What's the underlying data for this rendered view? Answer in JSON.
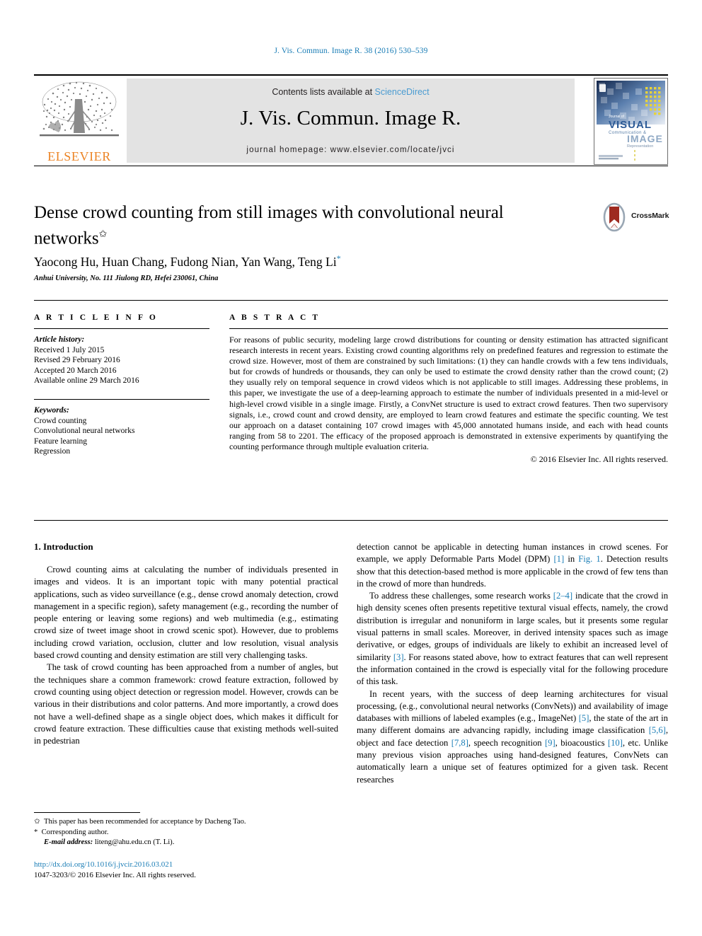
{
  "running_head": "J. Vis. Commun. Image R. 38 (2016) 530–539",
  "masthead": {
    "publisher_name": "ELSEVIER",
    "contents_prefix": "Contents lists available at ",
    "contents_link": "ScienceDirect",
    "journal_title": "J. Vis. Commun. Image R.",
    "homepage": "journal homepage: www.elsevier.com/locate/jvci",
    "cover_caption_1": "VISUAL",
    "cover_caption_2": "Communication &",
    "cover_caption_3": "IMAGE",
    "cover_caption_4": "Representation",
    "cover_caption_0": "Journal of"
  },
  "article": {
    "title": "Dense crowd counting from still images with convolutional neural networks",
    "title_marker": "✩",
    "authors": "Yaocong Hu, Huan Chang, Fudong Nian, Yan Wang, Teng Li",
    "author_marker": "*",
    "affiliation": "Anhui University, No. 111 Jiulong RD, Hefei 230061, China",
    "crossmark_label": "CrossMark"
  },
  "article_info": {
    "heading": "A R T I C L E   I N F O",
    "history_label": "Article history:",
    "history": [
      "Received 1 July 2015",
      "Revised 29 February 2016",
      "Accepted 20 March 2016",
      "Available online 29 March 2016"
    ],
    "keywords_label": "Keywords:",
    "keywords": [
      "Crowd counting",
      "Convolutional neural networks",
      "Feature learning",
      "Regression"
    ]
  },
  "abstract": {
    "heading": "A B S T R A C T",
    "text": "For reasons of public security, modeling large crowd distributions for counting or density estimation has attracted significant research interests in recent years. Existing crowd counting algorithms rely on predefined features and regression to estimate the crowd size. However, most of them are constrained by such limitations: (1) they can handle crowds with a few tens individuals, but for crowds of hundreds or thousands, they can only be used to estimate the crowd density rather than the crowd count; (2) they usually rely on temporal sequence in crowd videos which is not applicable to still images. Addressing these problems, in this paper, we investigate the use of a deep-learning approach to estimate the number of individuals presented in a mid-level or high-level crowd visible in a single image. Firstly, a ConvNet structure is used to extract crowd features. Then two supervisory signals, i.e., crowd count and crowd density, are employed to learn crowd features and estimate the specific counting. We test our approach on a dataset containing 107 crowd images with 45,000 annotated humans inside, and each with head counts ranging from 58 to 2201. The efficacy of the proposed approach is demonstrated in extensive experiments by quantifying the counting performance through multiple evaluation criteria.",
    "copyright": "© 2016 Elsevier Inc. All rights reserved."
  },
  "introduction": {
    "heading": "1. Introduction",
    "left_paragraphs": [
      "Crowd counting aims at calculating the number of individuals presented in images and videos. It is an important topic with many potential practical applications, such as video surveillance (e.g., dense crowd anomaly detection, crowd management in a specific region), safety management (e.g., recording the number of people entering or leaving some regions) and web multimedia (e.g., estimating crowd size of tweet image shoot in crowd scenic spot). However, due to problems including crowd variation, occlusion, clutter and low resolution, visual analysis based crowd counting and density estimation are still very challenging tasks.",
      "The task of crowd counting has been approached from a number of angles, but the techniques share a common framework: crowd feature extraction, followed by crowd counting using object detection or regression model. However, crowds can be various in their distributions and color patterns. And more importantly, a crowd does not have a well-defined shape as a single object does, which makes it difficult for crowd feature extraction. These difficulties cause that existing methods well-suited in pedestrian"
    ],
    "right_p1_a": "detection cannot be applicable in detecting human instances in crowd scenes. For example, we apply Deformable Parts Model (DPM) ",
    "right_p1_ref1": "[1]",
    "right_p1_b": " in ",
    "right_p1_ref2": "Fig. 1",
    "right_p1_c": ". Detection results show that this detection-based method is more applicable in the crowd of few tens than in the crowd of more than hundreds.",
    "right_p2_a": "To address these challenges, some research works ",
    "right_p2_ref1": "[2–4]",
    "right_p2_b": " indicate that the crowd in high density scenes often presents repetitive textural visual effects, namely, the crowd distribution is irregular and nonuniform in large scales, but it presents some regular visual patterns in small scales. Moreover, in derived intensity spaces such as image derivative, or edges, groups of individuals are likely to exhibit an increased level of similarity ",
    "right_p2_ref2": "[3]",
    "right_p2_c": ". For reasons stated above, how to extract features that can well represent the information contained in the crowd is especially vital for the following procedure of this task.",
    "right_p3_a": "In recent years, with the success of deep learning architectures for visual processing, (e.g., convolutional neural networks (ConvNets)) and availability of image databases with millions of labeled examples (e.g., ImageNet) ",
    "right_p3_ref1": "[5]",
    "right_p3_b": ", the state of the art in many different domains are advancing rapidly, including image classification ",
    "right_p3_ref2": "[5,6]",
    "right_p3_c": ", object and face detection ",
    "right_p3_ref3": "[7,8]",
    "right_p3_d": ", speech recognition ",
    "right_p3_ref4": "[9]",
    "right_p3_e": ", bioacoustics ",
    "right_p3_ref5": "[10]",
    "right_p3_f": ", etc. Unlike many previous vision approaches using hand-designed features, ConvNets can automatically learn a unique set of features optimized for a given task. Recent researches"
  },
  "footnotes": {
    "marker1": "✩",
    "note1": "This paper has been recommended for acceptance by Dacheng Tao.",
    "marker2": "*",
    "note2": "Corresponding author.",
    "email_label": "E-mail address:",
    "email": "liteng@ahu.edu.cn",
    "email_suffix": "(T. Li)."
  },
  "publication": {
    "doi_url": "http://dx.doi.org/10.1016/j.jvcir.2016.03.021",
    "issn_line": "1047-3203/© 2016 Elsevier Inc. All rights reserved."
  },
  "colors": {
    "link_blue": "#1a7db6",
    "sciencedirect_blue": "#4a9bd1",
    "elsevier_orange": "#ec8425",
    "band_grey": "#e3e3e3",
    "crossmark_red": "#9e2a20"
  }
}
